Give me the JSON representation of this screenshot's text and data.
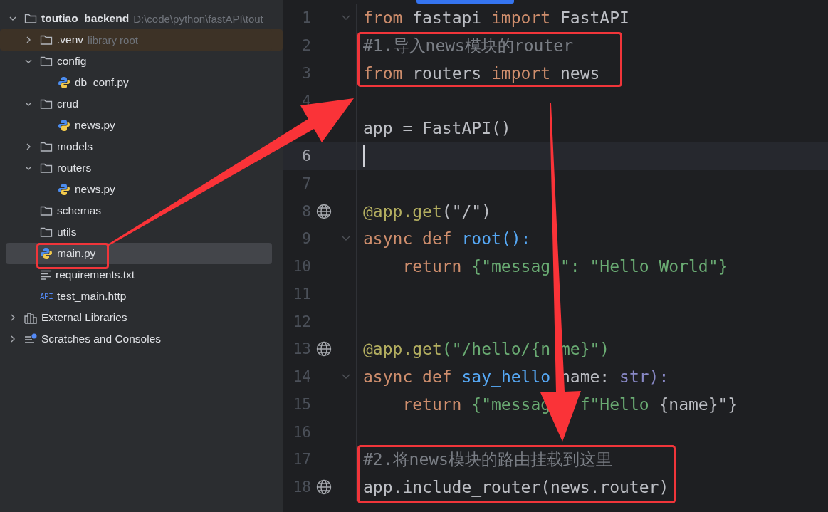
{
  "project_tree": [
    {
      "kind": "folder",
      "label": "toutiao_backend",
      "bold": true,
      "path": "D:\\code\\python\\fastAPI\\tout",
      "expanded": true,
      "selected": false,
      "children": [
        {
          "kind": "folder",
          "label": ".venv",
          "root_note": "library root",
          "expanded": false,
          "selected": false
        },
        {
          "kind": "folder",
          "label": "config",
          "expanded": true,
          "selected": false,
          "children": [
            {
              "kind": "python",
              "label": "db_conf.py",
              "selected": false
            }
          ]
        },
        {
          "kind": "folder",
          "label": "crud",
          "expanded": true,
          "selected": false,
          "children": [
            {
              "kind": "python",
              "label": "news.py",
              "selected": false
            }
          ]
        },
        {
          "kind": "folder",
          "label": "models",
          "expanded": false,
          "selected": false
        },
        {
          "kind": "folder",
          "label": "routers",
          "expanded": true,
          "selected": false,
          "children": [
            {
              "kind": "python",
              "label": "news.py",
              "selected": false
            }
          ]
        },
        {
          "kind": "folder",
          "label": "schemas",
          "selected": false
        },
        {
          "kind": "folder",
          "label": "utils",
          "selected": false
        },
        {
          "kind": "python",
          "label": "main.py",
          "selected": true
        },
        {
          "kind": "text",
          "label": "requirements.txt",
          "selected": false
        },
        {
          "kind": "api",
          "icon_text": "API",
          "label": "test_main.http",
          "selected": false
        }
      ]
    },
    {
      "kind": "library",
      "label": "External Libraries",
      "expanded": false,
      "selected": false
    },
    {
      "kind": "scratches",
      "label": "Scratches and Consoles",
      "expanded": false,
      "selected": false
    }
  ],
  "editor": {
    "lines": [
      {
        "number": "1",
        "kind": "fold",
        "current": false,
        "tokens": [
          {
            "t": "from",
            "kind": "keyword"
          },
          {
            "t": " fastapi ",
            "kind": "plain"
          },
          {
            "t": "import",
            "kind": "keyword"
          },
          {
            "t": " FastAPI",
            "kind": "plain"
          }
        ]
      },
      {
        "number": "2",
        "kind": "plain",
        "current": false,
        "tokens": [
          {
            "t": "#1.导入news模块的router",
            "kind": "comment"
          }
        ]
      },
      {
        "number": "3",
        "kind": "plain",
        "current": false,
        "tokens": [
          {
            "t": "from",
            "kind": "keyword"
          },
          {
            "t": " routers ",
            "kind": "plain"
          },
          {
            "t": "import",
            "kind": "keyword"
          },
          {
            "t": " news",
            "kind": "plain"
          }
        ]
      },
      {
        "number": "4",
        "kind": "plain",
        "current": false
      },
      {
        "kind": "plain",
        "current": false,
        "tokens": [
          {
            "t": "app = FastAPI()",
            "kind": "plain"
          }
        ]
      },
      {
        "number": "6",
        "kind": "plain",
        "current": true
      },
      {
        "number": "7",
        "kind": "plain",
        "current": false
      },
      {
        "number": "8",
        "kind": "globe",
        "current": false,
        "tokens": [
          {
            "t": "@app.get",
            "kind": "decorator"
          },
          {
            "t": "(\"/\")",
            "kind": "plain"
          }
        ]
      },
      {
        "number": "9",
        "kind": "fold",
        "current": false,
        "tokens": [
          {
            "t": "async",
            "kind": "keyword"
          },
          {
            "t": " def",
            "kind": "keyword"
          },
          {
            "t": " root():",
            "kind": "function"
          }
        ]
      },
      {
        "number": "10",
        "kind": "plain",
        "current": false,
        "tokens": [
          {
            "t": "    return",
            "kind": "keyword"
          },
          {
            "t": " {\"messag \": \"Hello World\"}",
            "kind": "string"
          }
        ]
      },
      {
        "number": "11",
        "kind": "plain",
        "current": false
      },
      {
        "number": "12",
        "kind": "plain",
        "current": false
      },
      {
        "number": "13",
        "kind": "globe",
        "current": false,
        "tokens": [
          {
            "t": "@app.get",
            "kind": "decorator"
          },
          {
            "t": "(\"/hello/{n me}\")",
            "kind": "string"
          }
        ]
      },
      {
        "number": "14",
        "kind": "fold",
        "current": false,
        "tokens": [
          {
            "t": "async",
            "kind": "keyword"
          },
          {
            "t": " def",
            "kind": "keyword"
          },
          {
            "t": " say_hello",
            "kind": "function"
          },
          {
            "t": " name: ",
            "kind": "plain"
          },
          {
            "t": "str):",
            "kind": "builtin"
          }
        ]
      },
      {
        "number": "15",
        "kind": "plain",
        "current": false,
        "tokens": [
          {
            "t": "    return",
            "kind": "keyword"
          },
          {
            "t": " {\"messag   f\"Hello ",
            "kind": "string"
          },
          {
            "t": "{name}\"}",
            "kind": "plain"
          }
        ]
      },
      {
        "number": "16",
        "kind": "plain",
        "current": false
      },
      {
        "number": "17",
        "kind": "plain",
        "current": false,
        "tokens": [
          {
            "t": "#2.将news模块的路由挂载到这里",
            "kind": "comment"
          }
        ]
      },
      {
        "number": "18",
        "kind": "globe",
        "current": false,
        "tokens": [
          {
            "t": "app.include_router(news.router)",
            "kind": "plain"
          }
        ]
      }
    ]
  }
}
